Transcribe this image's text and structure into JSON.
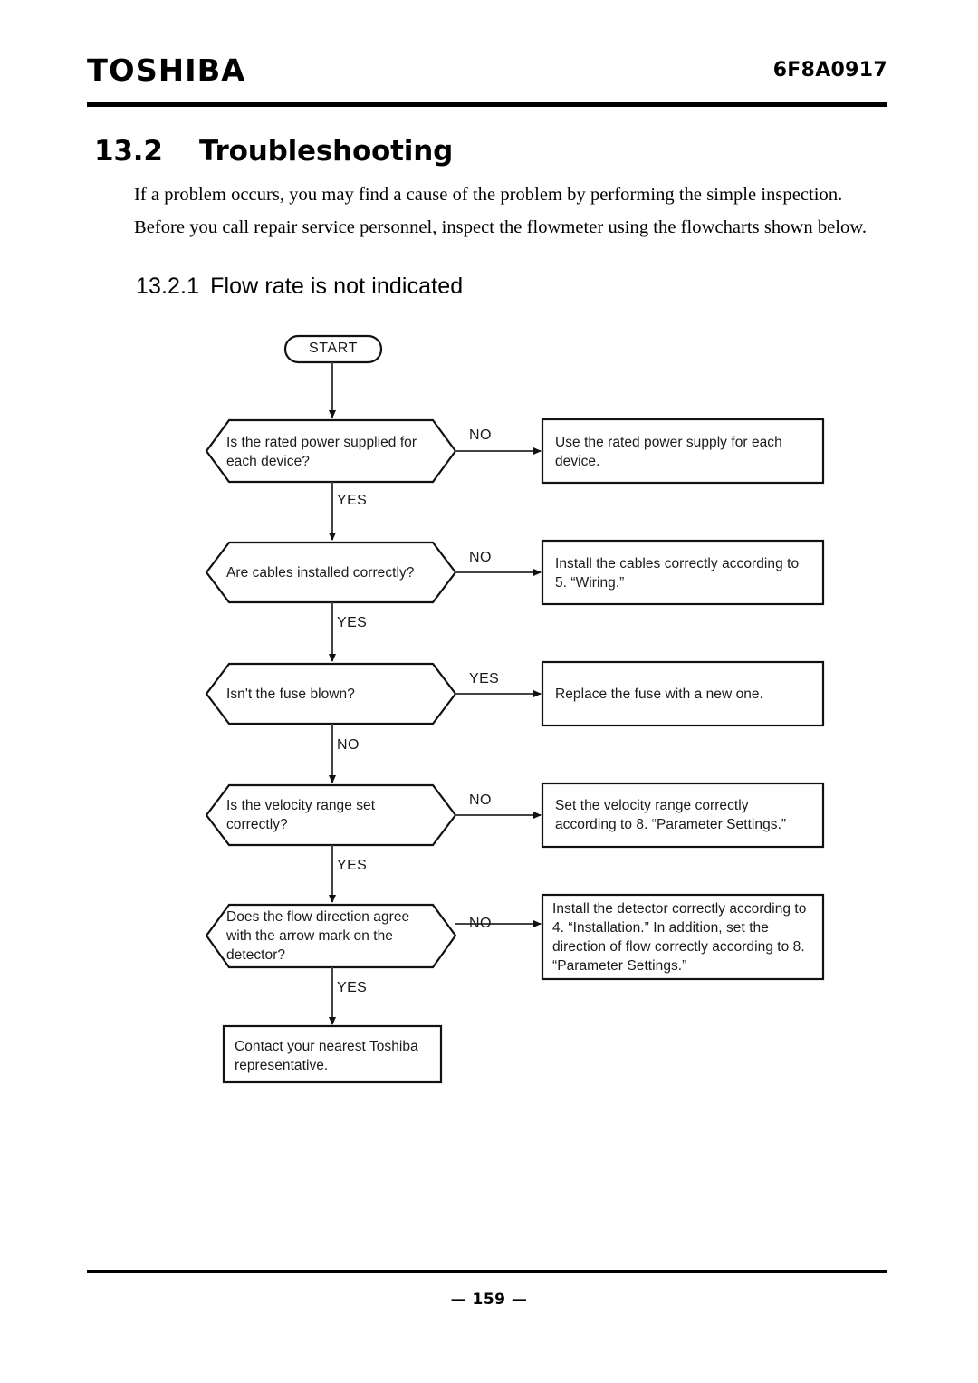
{
  "header": {
    "brand": "TOSHIBA",
    "doc_code": "6F8A0917"
  },
  "section": {
    "number": "13.2",
    "title": "Troubleshooting",
    "paragraphs": [
      "If a problem occurs, you may find a cause of the problem by performing the simple inspection.",
      "Before you call repair service personnel, inspect the flowmeter using the flowcharts shown below."
    ],
    "subsection_number": "13.2.1",
    "subsection_title": "Flow rate is not indicated"
  },
  "flowchart": {
    "start_label": "START",
    "steps": [
      {
        "decision": "Is the rated power supplied for each device?",
        "decision_lines": [
          "Is the rated power supplied for",
          "each device?"
        ],
        "branch_right": "NO",
        "branch_down": "YES",
        "action": "Use the rated power supply for each device.",
        "action_lines": [
          "Use the rated power supply for each",
          "device."
        ]
      },
      {
        "decision": "Are cables installed correctly?",
        "decision_lines": [
          "Are cables installed correctly?"
        ],
        "branch_right": "NO",
        "branch_down": "YES",
        "action": "Install the cables correctly according to 5. “Wiring.”",
        "action_lines": [
          "Install the cables correctly according to",
          "5. “Wiring.”"
        ]
      },
      {
        "decision": "Isn't the fuse blown?",
        "decision_lines": [
          "Isn't the fuse blown?"
        ],
        "branch_right": "YES",
        "branch_down": "NO",
        "action": "Replace the fuse with a new one.",
        "action_lines": [
          "Replace the fuse with a new one."
        ]
      },
      {
        "decision": "Is the velocity range set correctly?",
        "decision_lines": [
          "Is the velocity range set",
          "correctly?"
        ],
        "branch_right": "NO",
        "branch_down": "YES",
        "action": "Set the velocity range correctly according to 8. “Parameter Settings.”",
        "action_lines": [
          "Set the velocity range correctly",
          "according to 8. “Parameter Settings.”"
        ]
      },
      {
        "decision": "Does the flow direction agree with the arrow mark on the detector?",
        "decision_lines": [
          "Does the flow direction agree",
          "with the arrow mark on the",
          "detector?"
        ],
        "branch_right": "NO",
        "branch_down": "YES",
        "action": "Install the detector correctly according to 4. “Installation.” In addition, set the direction of flow correctly according to 8. “Parameter Settings.”",
        "action_lines": [
          "Install the detector correctly according to",
          "4. “Installation.” In addition, set the",
          "direction of flow correctly according to 8.",
          "“Parameter Settings.”"
        ]
      }
    ],
    "terminal": "Contact your nearest Toshiba representative.",
    "terminal_lines": [
      "Contact your nearest Toshiba",
      "representative."
    ]
  },
  "footer": {
    "page_number": "—  159  —"
  }
}
